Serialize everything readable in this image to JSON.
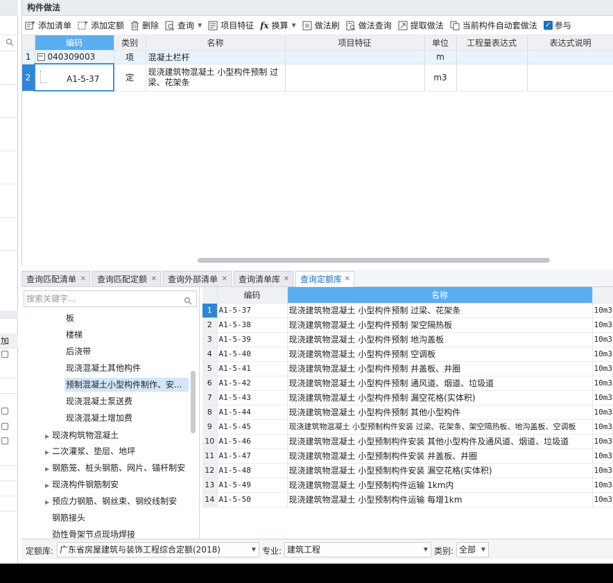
{
  "panel_title": "构件做法",
  "toolbar": {
    "add_list": "添加清单",
    "add_quota": "添加定额",
    "delete": "删除",
    "query": "查询",
    "item_feature": "项目特征",
    "convert": "换算",
    "method_brush": "做法刷",
    "method_query": "做法查询",
    "extract_method": "提取做法",
    "auto_apply": "当前构件自动套做法",
    "participate": "参与"
  },
  "clause_table": {
    "headers": [
      "编码",
      "类别",
      "名称",
      "项目特征",
      "单位",
      "工程量表达式",
      "表达式说明"
    ],
    "rows": [
      {
        "no": "1",
        "code": "040309003",
        "category": "项",
        "name": "混凝土栏杆",
        "feature": "",
        "unit": "m",
        "expr": "",
        "desc": ""
      },
      {
        "no": "2",
        "code": "A1-5-37",
        "category": "定",
        "name": "现浇建筑物混凝土 小型构件预制 过梁、花架条",
        "feature": "",
        "unit": "m3",
        "expr": "",
        "desc": ""
      }
    ]
  },
  "tabs": [
    "查询匹配清单",
    "查询匹配定额",
    "查询外部清单",
    "查询清单库",
    "查询定额库"
  ],
  "search_placeholder": "搜索关键字...",
  "tree": {
    "items": [
      "板",
      "楼梯",
      "后浇带",
      "现浇混凝土其他构件",
      "预制混凝土小型构件制作、安...",
      "现浇混凝土泵送费",
      "现浇混凝土增加费",
      "现浇构筑物混凝土",
      "二次灌浆、垫层、地坪",
      "钢筋笼、桩头钢筋、网片、锚杆制安",
      "现浇构件钢筋制安",
      "预应力钢筋、钢丝束、钢绞线制安",
      "钢筋接头",
      "劲性骨架节点现场焊接"
    ]
  },
  "quota_table": {
    "headers": [
      "编码",
      "名称"
    ],
    "rows": [
      {
        "no": "1",
        "code": "A1-5-37",
        "name": "现浇建筑物混凝土 小型构件预制 过梁、花架条",
        "unit": "10m3"
      },
      {
        "no": "2",
        "code": "A1-5-38",
        "name": "现浇建筑物混凝土 小型构件预制 架空隔热板",
        "unit": "10m3"
      },
      {
        "no": "3",
        "code": "A1-5-39",
        "name": "现浇建筑物混凝土 小型构件预制 地沟盖板",
        "unit": "10m3"
      },
      {
        "no": "4",
        "code": "A1-5-40",
        "name": "现浇建筑物混凝土 小型构件预制 空调板",
        "unit": "10m3"
      },
      {
        "no": "5",
        "code": "A1-5-41",
        "name": "现浇建筑物混凝土 小型构件预制 井盖板、井圈",
        "unit": "10m3"
      },
      {
        "no": "6",
        "code": "A1-5-42",
        "name": "现浇建筑物混凝土 小型构件预制 通风道、烟道、垃圾道",
        "unit": "10m3"
      },
      {
        "no": "7",
        "code": "A1-5-43",
        "name": "现浇建筑物混凝土 小型构件预制 漏空花格(实体积)",
        "unit": "10m3"
      },
      {
        "no": "8",
        "code": "A1-5-44",
        "name": "现浇建筑物混凝土 小型构件预制 其他小型构件",
        "unit": "10m3"
      },
      {
        "no": "9",
        "code": "A1-5-45",
        "name": "现浇建筑物混凝土 小型预制构件安装 过梁、花架条、架空隔热板、地沟盖板、空调板",
        "unit": "10m3"
      },
      {
        "no": "10",
        "code": "A1-5-46",
        "name": "现浇建筑物混凝土 小型预制构件安装 其他小型构件及通风道、烟道、垃圾道",
        "unit": "10m3"
      },
      {
        "no": "11",
        "code": "A1-5-47",
        "name": "现浇建筑物混凝土 小型预制构件安装 井盖板、井圈",
        "unit": "10m3"
      },
      {
        "no": "12",
        "code": "A1-5-48",
        "name": "现浇建筑物混凝土 小型预制构件安装 漏空花格(实体积)",
        "unit": "10m3"
      },
      {
        "no": "13",
        "code": "A1-5-49",
        "name": "现浇建筑物混凝土 小型预制构件运输 1km内",
        "unit": "10m3"
      },
      {
        "no": "14",
        "code": "A1-5-50",
        "name": "现浇建筑物混凝土 小型预制构件运输 每增1km",
        "unit": "10m3"
      }
    ]
  },
  "footer": {
    "quota_lib_label": "定额库:",
    "quota_lib_value": "广东省房屋建筑与装饰工程综合定额(2018)",
    "major_label": "专业:",
    "major_value": "建筑工程",
    "category_label": "类别:",
    "category_value": "全部"
  },
  "left_strip": {
    "header": "加"
  }
}
